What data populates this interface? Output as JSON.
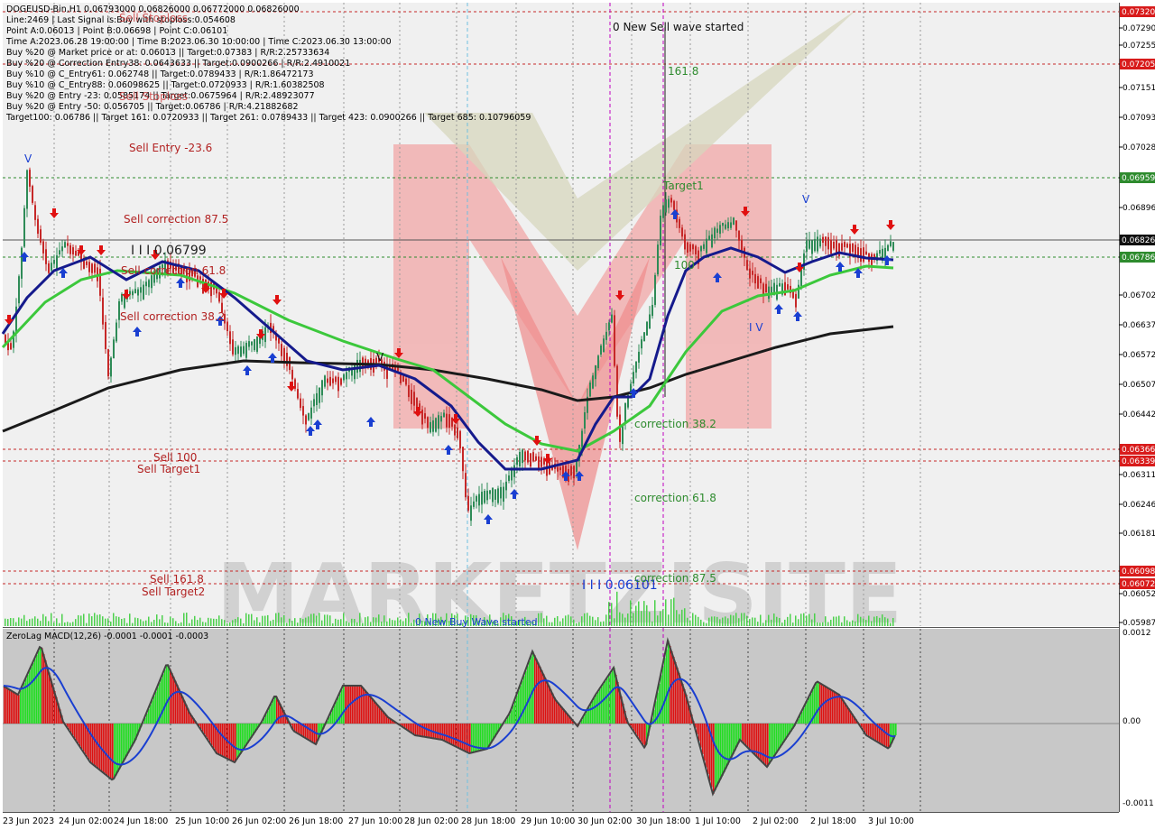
{
  "header": {
    "lines": [
      "DOGEUSD-Bin,H1  0.06793000 0.06826000 0.06772000 0.06826000",
      "Line:2469 | Last Signal is:Buy with stoploss:0.054608",
      "Point A:0.06013 | Point B:0.06698 | Point C:0.06101",
      "Time A:2023.06.28 19:00:00 | Time B:2023.06.30 10:00:00 | Time C:2023.06.30 13:00:00",
      "Buy %20 @ Market price or at: 0.06013 || Target:0.07383 | R/R:2.25733634",
      "Buy %20 @ Correction Entry38: 0.0643633 || Target:0.0900266 | R/R:2.4910021",
      "Buy %10 @ C_Entry61: 0.062748 || Target:0.0789433 | R/R:1.86472173",
      "Buy %10 @ C_Entry88: 0.06098625 || Target:0.0720933 | R/R:1.60382508",
      "Buy %20 @ Entry -23: 0.0585174 || Target:0.0675964 | R/R:2.48923077",
      "Buy %20 @ Entry -50: 0.056705 || Target:0.06786 | R/R:4.21882682",
      "Target100: 0.06786 || Target 161: 0.0720933 || Target 261: 0.0789433 || Target 423: 0.0900266 || Target 685: 0.10796059"
    ],
    "overlay_labels": [
      "Sell Stoploss",
      "Sell Stoploss"
    ]
  },
  "main_chart": {
    "price_ticks": [
      "0.07290",
      "0.07255",
      "0.07185",
      "0.07151",
      "0.07093",
      "0.07028",
      "0.06959",
      "0.06896",
      "0.06826",
      "0.06786",
      "0.06702",
      "0.06637",
      "0.06572",
      "0.06507",
      "0.06442",
      "0.06366",
      "0.06339",
      "0.06311",
      "0.06246",
      "0.06181",
      "0.06098",
      "0.06072",
      "0.06052",
      "0.05987"
    ],
    "badges": [
      {
        "label": "0.07320",
        "color": "#d81b1b"
      },
      {
        "label": "0.07205",
        "color": "#d81b1b"
      },
      {
        "label": "0.06959",
        "color": "#2e8b2e"
      },
      {
        "label": "0.06826",
        "color": "#111111"
      },
      {
        "label": "0.06786",
        "color": "#2e8b2e"
      },
      {
        "label": "0.06366",
        "color": "#d81b1b"
      },
      {
        "label": "0.06339",
        "color": "#d81b1b"
      },
      {
        "label": "0.06098",
        "color": "#d81b1b"
      },
      {
        "label": "0.06072",
        "color": "#d81b1b"
      }
    ],
    "annotations": {
      "sell_entry": "Sell Entry -23.6",
      "sell_correction_875": "Sell correction 87.5",
      "sell_correction_618": "Sell correction 61.8",
      "sell_correction_382": "Sell correction 38.2",
      "sell_100": "Sell 100",
      "sell_target1": "Sell Target1",
      "sell_1618": "Sell 161.8",
      "sell_target2": "Sell Target2",
      "level_high": "I I I 0.06799",
      "level_low": "I I I 0.06101",
      "new_sell_wave": "0 New Sell wave started",
      "new_buy_wave": "0 New Buy Wave started",
      "fib_1618": "161.8",
      "target1": "Target1",
      "fib_100": "100",
      "corr_382": "correction 38.2",
      "corr_618": "correction 61.8",
      "corr_875": "correction 87.5",
      "wave_iv": "I V",
      "wave_v": "V"
    },
    "watermark": "MARKETZISITE"
  },
  "indicator": {
    "label": "ZeroLag MACD(12,26) -0.0001 -0.0001 -0.0003",
    "ticks": [
      "0.0012",
      "0.00",
      "-0.0011"
    ]
  },
  "time_axis": [
    "23 Jun 2023",
    "24 Jun 02:00",
    "24 Jun 18:00",
    "25 Jun 10:00",
    "26 Jun 02:00",
    "26 Jun 18:00",
    "27 Jun 10:00",
    "28 Jun 02:00",
    "28 Jun 18:00",
    "29 Jun 10:00",
    "30 Jun 02:00",
    "30 Jun 18:00",
    "1 Jul 10:00",
    "2 Jul 02:00",
    "2 Jul 18:00",
    "3 Jul 10:00"
  ],
  "colors": {
    "up_candle": "#2e8b57",
    "down_candle": "#c62828",
    "buy_arrow": "#1a3fd1",
    "sell_arrow": "#e01010",
    "ma_blue": "#151a8c",
    "ma_green": "#3cc83c",
    "ma_black": "#1a1a1a",
    "macd_green": "#22dd22",
    "macd_red": "#dd1111",
    "signal": "#1a3fd1"
  }
}
